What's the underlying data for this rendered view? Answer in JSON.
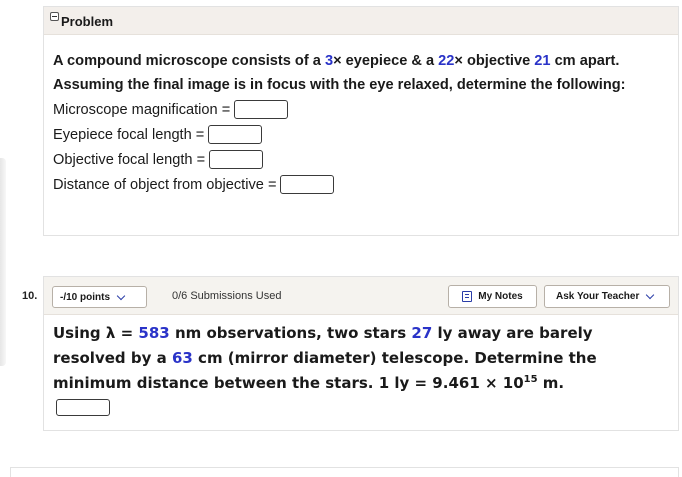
{
  "problem": {
    "header_label": "Problem",
    "question": {
      "p1": "A compound microscope consists of a ",
      "eyepiece_mag": "3",
      "p2": "× eyepiece & a ",
      "objective_mag": "22",
      "p3": "× objective ",
      "separation": "21",
      "p4": " cm apart. Assuming the final image is in focus with the eye relaxed, determine the following:"
    },
    "fields": [
      {
        "label": "Microscope magnification =",
        "value": ""
      },
      {
        "label": "Eyepiece focal length =",
        "value": ""
      },
      {
        "label": "Objective focal length =",
        "value": ""
      },
      {
        "label": "Distance of object from objective =",
        "value": ""
      }
    ]
  },
  "question10": {
    "number": "10.",
    "points_label": "-/10 points",
    "submissions": "0/6 Submissions Used",
    "my_notes_label": "My Notes",
    "ask_teacher_label": "Ask Your Teacher",
    "text": {
      "t1": "Using λ = ",
      "wavelength": "583",
      "t2": " nm observations, two stars ",
      "distance": "27",
      "t3": " ly away are barely resolved by a ",
      "diameter": "63",
      "t4": " cm (mirror diameter) telescope. Determine the minimum distance between the stars. 1 ly = 9.461 × 10",
      "exponent": "15",
      "t5": " m."
    },
    "answer_value": ""
  }
}
